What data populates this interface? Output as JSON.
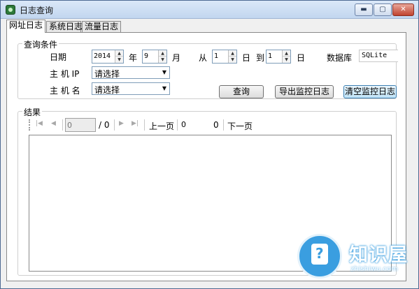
{
  "window": {
    "title": "日志查询",
    "buttons": {
      "minimize": "▬",
      "maximize": "▢",
      "close": "✕"
    }
  },
  "tabs": [
    {
      "label": "网址日志",
      "active": true
    },
    {
      "label": "系统日志",
      "active": false
    },
    {
      "label": "流量日志",
      "active": false
    }
  ],
  "query": {
    "group_title": "查询条件",
    "date_label": "日期",
    "year_value": "2014",
    "year_unit": "年",
    "month_value": "9",
    "month_unit": "月",
    "from_label": "从",
    "from_value": "1",
    "day_unit_1": "日",
    "to_label": "到",
    "to_value": "1",
    "day_unit_2": "日",
    "db_label": "数据库",
    "db_value": "SQLite",
    "host_ip_label": "主 机 IP",
    "host_ip_value": "请选择",
    "host_name_label": "主 机 名",
    "host_name_value": "请选择",
    "query_button": "查询",
    "export_button": "导出监控日志",
    "clear_button": "清空监控日志"
  },
  "results": {
    "group_title": "结果",
    "current_page": "0",
    "total_pages": "/ 0",
    "prev_label": "上一页",
    "count_left": "0",
    "count_right": "0",
    "next_label": "下一页"
  },
  "watermark": {
    "name": "知识屋",
    "url": "zhishiwu.com"
  },
  "colors": {
    "title_bar": "#c2d6ef",
    "close_button": "#c0432f",
    "watermark": "#3a9ee0"
  }
}
